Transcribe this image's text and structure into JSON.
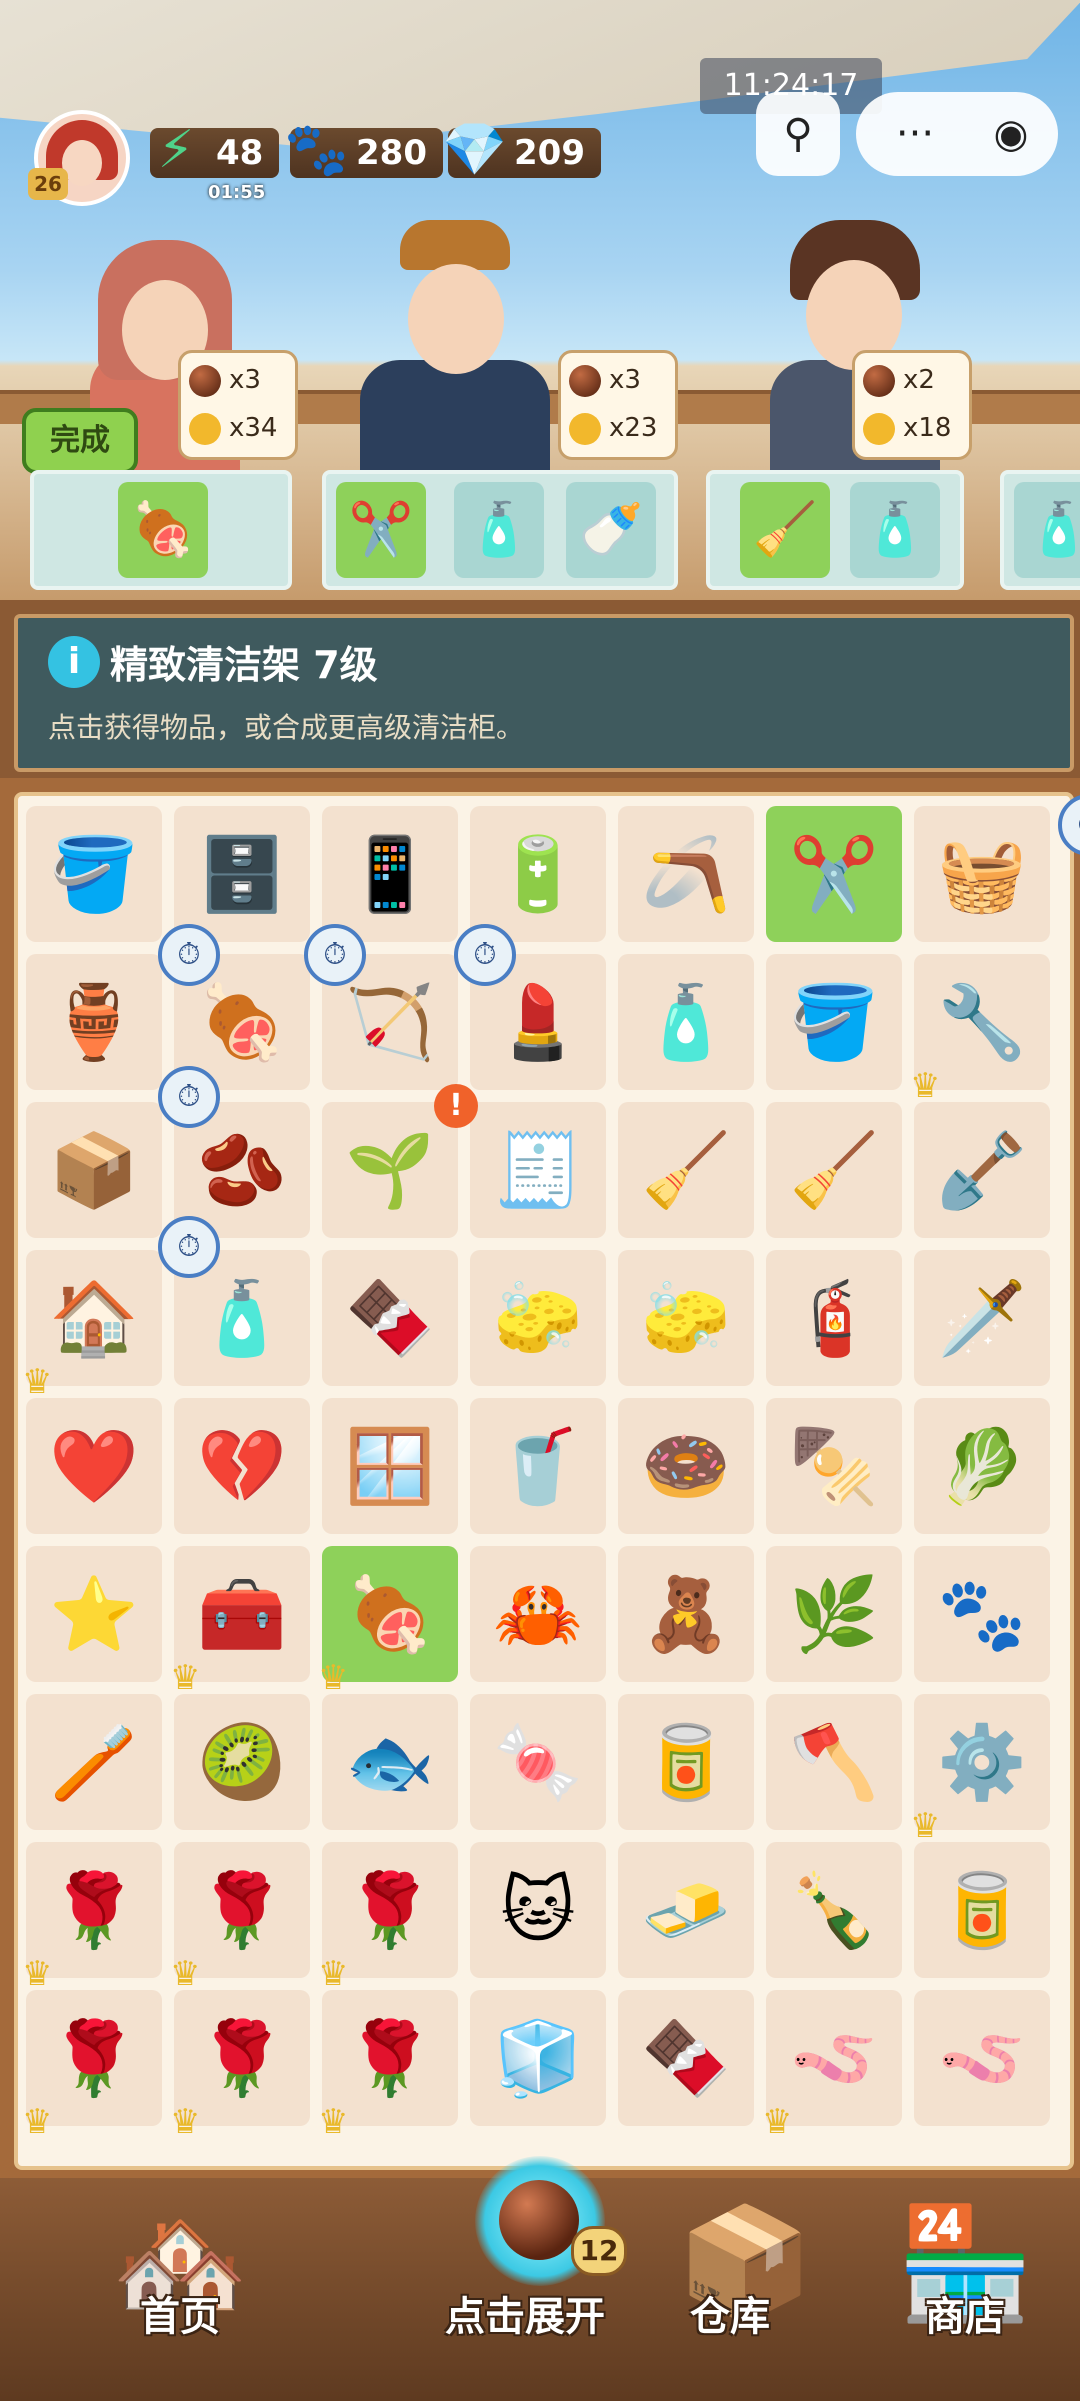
{
  "status_bar": {
    "clock": "11:24:17"
  },
  "player": {
    "level": "26",
    "energy": "48",
    "energy_timer": "01:55",
    "paw_coins": "280",
    "gems": "209"
  },
  "mini_program": {
    "menu_dots": "···"
  },
  "customers": [
    {
      "ball_qty": "x3",
      "paw_qty": "x34"
    },
    {
      "ball_qty": "x3",
      "paw_qty": "x23"
    },
    {
      "ball_qty": "x2",
      "paw_qty": "x18"
    }
  ],
  "complete_button": "完成",
  "info": {
    "icon": "i",
    "title": "精致清洁架 7级",
    "description": "点击获得物品，或合成更高级清洁柜。"
  },
  "board": {
    "rows": [
      [
        "🪣",
        "🗄️",
        "📱",
        "🔋",
        "🪃",
        "✂️",
        "🧺"
      ],
      [
        "🏺",
        "🍖",
        "🏹",
        "💄",
        "🧴",
        "🪣",
        "🔧"
      ],
      [
        "📦",
        "🫘",
        "🌱",
        "🧾",
        "🧹",
        "🧹",
        "🪏"
      ],
      [
        "🏠",
        "🧴",
        "🍫",
        "🧽",
        "🧽",
        "🧯",
        "🗡️"
      ],
      [
        "❤️",
        "💔",
        "🪟",
        "🥤",
        "🍩",
        "🍢",
        "🥬"
      ],
      [
        "⭐",
        "🧰",
        "🍖",
        "🦀",
        "🧸",
        "🌿",
        "🐾"
      ],
      [
        "🪥",
        "🥝",
        "🐟",
        "🍬",
        "🥫",
        "🪓",
        "⚙️"
      ],
      [
        "🌹",
        "🌹",
        "🌹",
        "🐱",
        "🧈",
        "🍾",
        "🥫"
      ],
      [
        "🌹",
        "🌹",
        "🌹",
        "🧊",
        "🍫",
        "🪱",
        "🪱"
      ]
    ]
  },
  "nav": {
    "home": "首页",
    "expand": "点击展开",
    "expand_count": "12",
    "storage": "仓库",
    "shop": "商店"
  }
}
